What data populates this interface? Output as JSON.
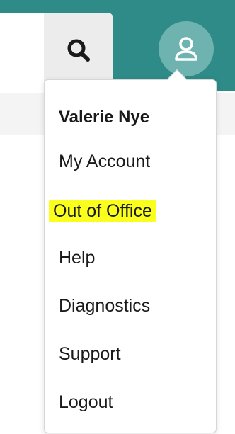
{
  "header": {
    "accent_color": "#2e8b87",
    "search_icon": "search-icon",
    "user_icon": "user-icon"
  },
  "menu": {
    "user_name": "Valerie Nye",
    "items": [
      {
        "label": "My Account"
      },
      {
        "label": "Out of Office",
        "highlighted": true,
        "highlight_color": "#fbff1e"
      },
      {
        "label": "Help"
      },
      {
        "label": "Diagnostics"
      },
      {
        "label": "Support"
      },
      {
        "label": "Logout"
      }
    ]
  }
}
